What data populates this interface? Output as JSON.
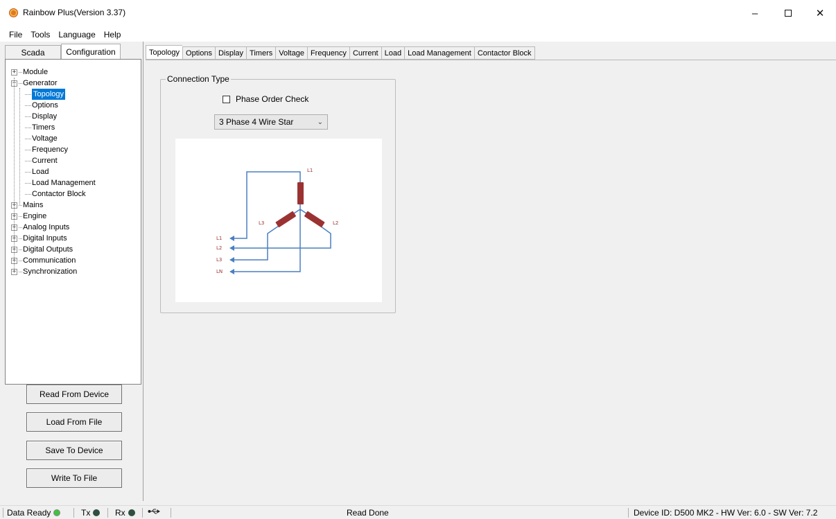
{
  "window": {
    "title": "Rainbow Plus(Version 3.37)",
    "min": "–",
    "close": "✕"
  },
  "menu": [
    "File",
    "Tools",
    "Language",
    "Help"
  ],
  "left_tabs": [
    "Scada",
    "Configuration"
  ],
  "tree": {
    "module": "Module",
    "generator": "Generator",
    "generator_children": [
      "Topology",
      "Options",
      "Display",
      "Timers",
      "Voltage",
      "Frequency",
      "Current",
      "Load",
      "Load Management",
      "Contactor Block"
    ],
    "others": [
      "Mains",
      "Engine",
      "Analog Inputs",
      "Digital Inputs",
      "Digital Outputs",
      "Communication",
      "Synchronization"
    ]
  },
  "side_buttons": [
    "Read From Device",
    "Load From File",
    "Save To Device",
    "Write To File"
  ],
  "main_tabs": [
    "Topology",
    "Options",
    "Display",
    "Timers",
    "Voltage",
    "Frequency",
    "Current",
    "Load",
    "Load Management",
    "Contactor Block"
  ],
  "connection": {
    "group_title": "Connection Type",
    "phase_order_check": "Phase Order Check",
    "phase_order_checked": false,
    "selected_type": "3 Phase  4 Wire Star"
  },
  "diagram_labels": {
    "l1": "L1",
    "l2": "L2",
    "l3": "L3",
    "ln": "LN"
  },
  "status": {
    "data_ready": "Data Ready",
    "tx": "Tx",
    "rx": "Rx",
    "message": "Read Done",
    "device": "Device ID: D500 MK2 - HW Ver: 6.0 - SW Ver: 7.2",
    "data_ready_color": "#3ec43e",
    "tx_color": "#2f4f3f",
    "rx_color": "#2f4f3f"
  },
  "colors": {
    "wire": "#4a7fc1",
    "coil": "#9b3232",
    "selection": "#0078d7"
  }
}
